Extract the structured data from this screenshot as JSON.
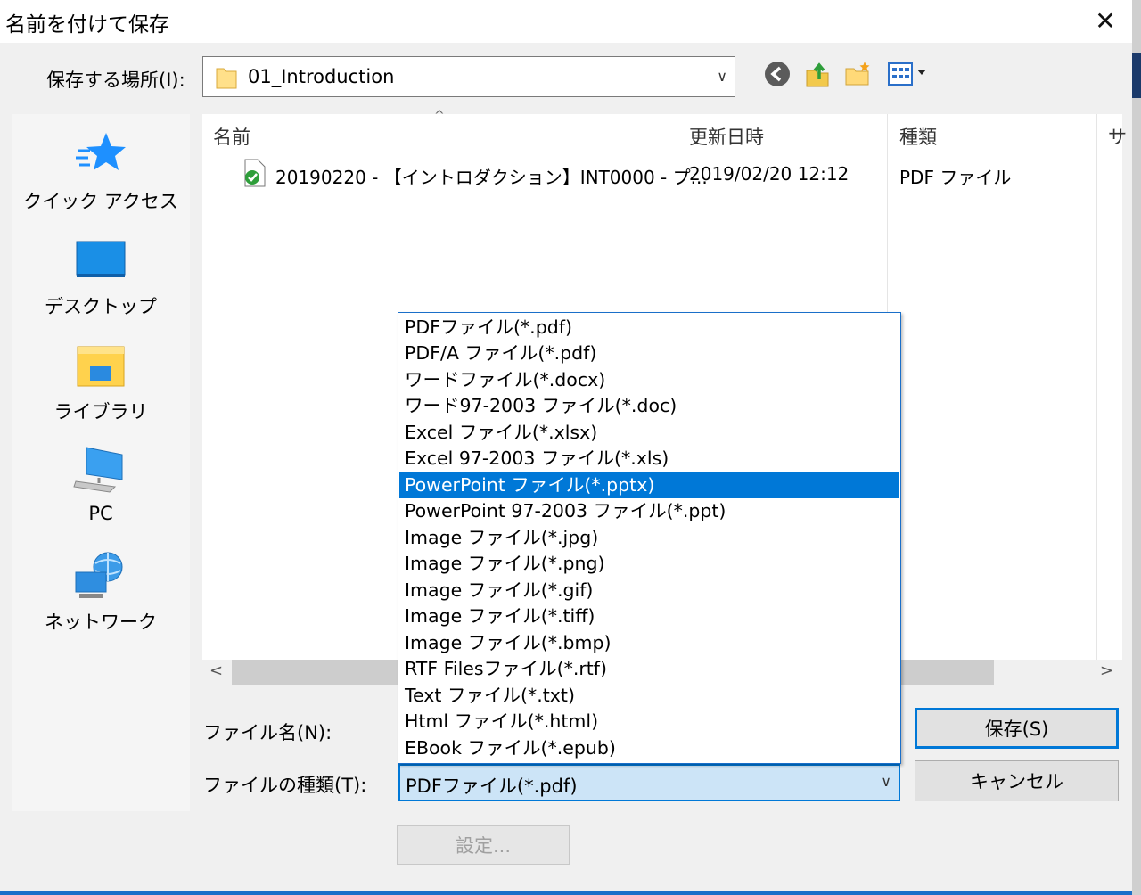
{
  "window": {
    "title": "名前を付けて保存",
    "close_glyph": "✕"
  },
  "lookin": {
    "label": "保存する場所(I):",
    "value": "01_Introduction"
  },
  "places": [
    {
      "label": "クイック アクセス",
      "icon": "star-icon"
    },
    {
      "label": "デスクトップ",
      "icon": "desktop-icon"
    },
    {
      "label": "ライブラリ",
      "icon": "library-icon"
    },
    {
      "label": "PC",
      "icon": "computer-icon"
    },
    {
      "label": "ネットワーク",
      "icon": "network-icon"
    }
  ],
  "filelist": {
    "columns": [
      "名前",
      "更新日時",
      "種類",
      "サ"
    ],
    "rows": [
      {
        "name": "20190220 - 【イントロダクション】INT0000 - プ...",
        "date": "2019/02/20 12:12",
        "type": "PDF ファイル",
        "icon": "pdf-file-icon"
      }
    ]
  },
  "form": {
    "filename_label": "ファイル名(N):",
    "filetype_label": "ファイルの種類(T):",
    "filetype_value": "PDFファイル(*.pdf)"
  },
  "dropdown": {
    "options": [
      "PDFファイル(*.pdf)",
      "PDF/A ファイル(*.pdf)",
      "ワードファイル(*.docx)",
      "ワード97-2003 ファイル(*.doc)",
      "Excel ファイル(*.xlsx)",
      "Excel 97-2003 ファイル(*.xls)",
      "PowerPoint ファイル(*.pptx)",
      "PowerPoint 97-2003 ファイル(*.ppt)",
      "Image ファイル(*.jpg)",
      "Image ファイル(*.png)",
      "Image ファイル(*.gif)",
      "Image ファイル(*.tiff)",
      "Image ファイル(*.bmp)",
      "RTF Filesファイル(*.rtf)",
      "Text ファイル(*.txt)",
      "Html ファイル(*.html)",
      "EBook ファイル(*.epub)"
    ],
    "highlighted": "PowerPoint ファイル(*.pptx)"
  },
  "buttons": {
    "save": "保存(S)",
    "cancel": "キャンセル",
    "settings": "設定..."
  },
  "colors": {
    "accent": "#0078d7",
    "selection": "#0078d7",
    "combo_focus_bg": "#cce4f7"
  }
}
